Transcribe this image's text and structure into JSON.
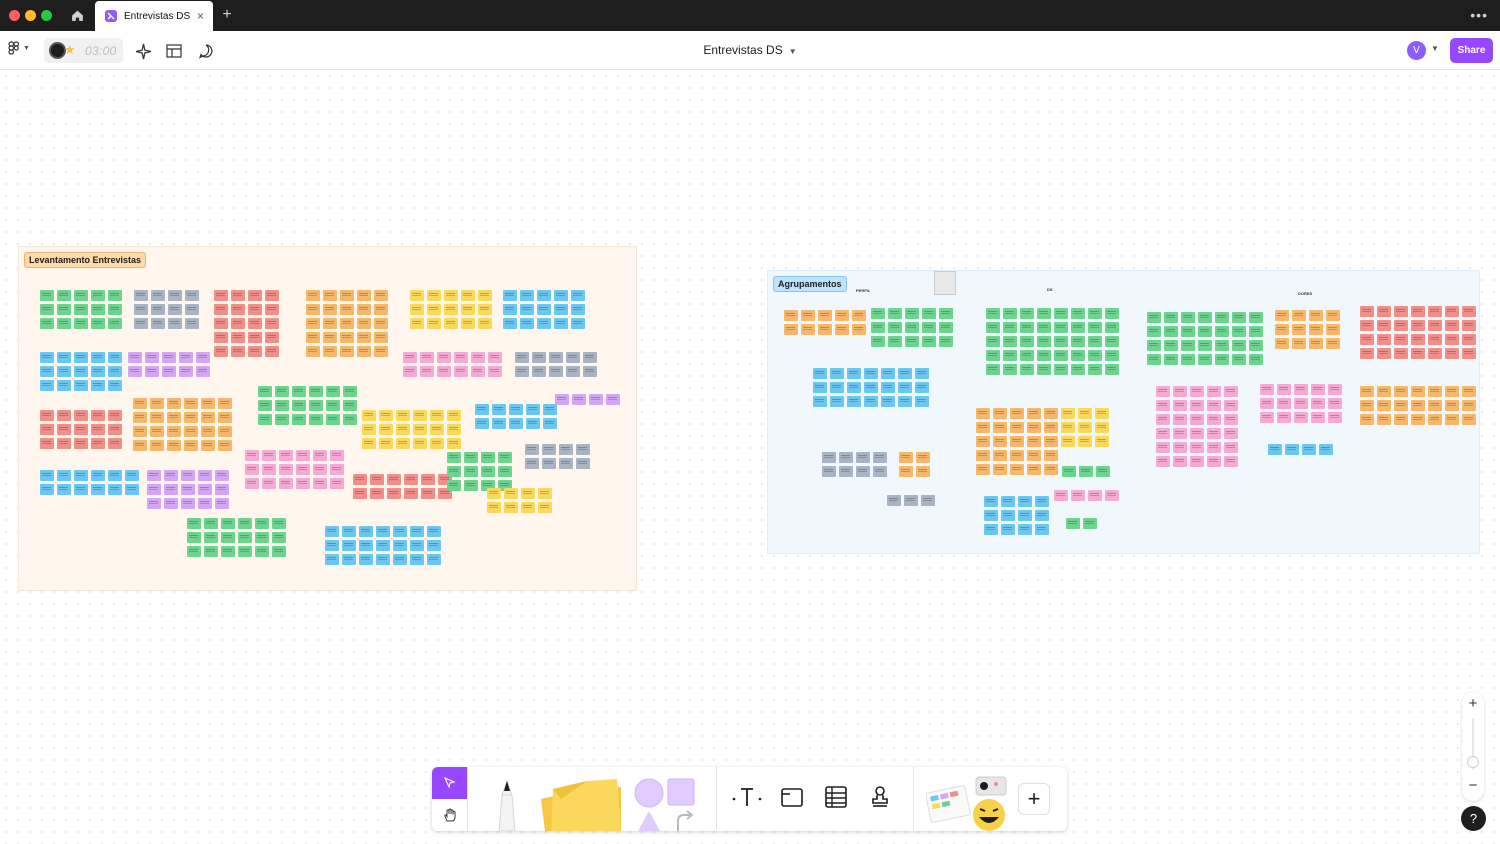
{
  "window": {
    "tab_title": "Entrevistas DS",
    "new_tab_symbol": "+",
    "close_symbol": "×",
    "more_symbol": "•••"
  },
  "toolbar": {
    "timer_text": "03:00",
    "file_title": "Entrevistas DS",
    "avatar_initial": "V",
    "share_label": "Share"
  },
  "canvas": {
    "sections": [
      {
        "label": "Levantamento Entrevistas",
        "color": "#ffd9a8"
      },
      {
        "label": "Agrupamentos",
        "color": "#bde3ff"
      }
    ],
    "right_headings": [
      "PERFIL",
      "DS",
      "DORES"
    ]
  },
  "dock": {
    "tools": [
      "select",
      "hand",
      "pen",
      "sticky-note",
      "shapes",
      "text",
      "section",
      "table",
      "stamp",
      "widgets",
      "more-tools"
    ],
    "add_symbol": "+"
  },
  "zoom": {
    "in_symbol": "+",
    "out_symbol": "−"
  },
  "help": {
    "symbol": "?"
  },
  "colors": {
    "accent": "#9747ff",
    "green": "#6fd390",
    "gray": "#a8b4c4",
    "red": "#f08f8a",
    "orange": "#f7b76a",
    "yellow": "#f9d85b",
    "blue": "#6cc6f2",
    "purple": "#d4a5f2",
    "pink": "#f5a9d3"
  }
}
